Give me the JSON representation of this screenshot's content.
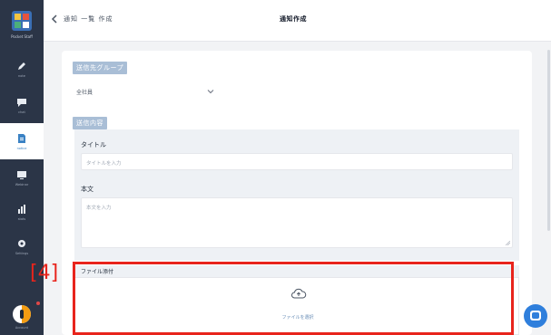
{
  "app": {
    "sidebar_brand": "Pocket Staff"
  },
  "sidebar": {
    "items": [
      {
        "icon": "pen-icon",
        "label": "note"
      },
      {
        "icon": "chat-bubble-icon",
        "label": "chat"
      },
      {
        "icon": "document-icon",
        "label": "notice"
      },
      {
        "icon": "monitor-icon",
        "label": "Webinar"
      },
      {
        "icon": "bar-chart-icon",
        "label": "stats"
      },
      {
        "icon": "gear-icon",
        "label": "Settings"
      }
    ],
    "account_label": "Account"
  },
  "header": {
    "breadcrumb": "通知 一覧 作成",
    "title": "通知作成"
  },
  "form": {
    "target_section": "送信先グループ",
    "target_value": "全社員",
    "content_section": "送信内容",
    "title_label": "タイトル",
    "title_placeholder": "タイトルを入力",
    "body_label": "本文",
    "body_placeholder": "本文を入力",
    "file_label": "ファイル添付",
    "upload_text": "ファイルを選択"
  },
  "annotation": {
    "label": "[4]",
    "color": "#e8241c"
  }
}
